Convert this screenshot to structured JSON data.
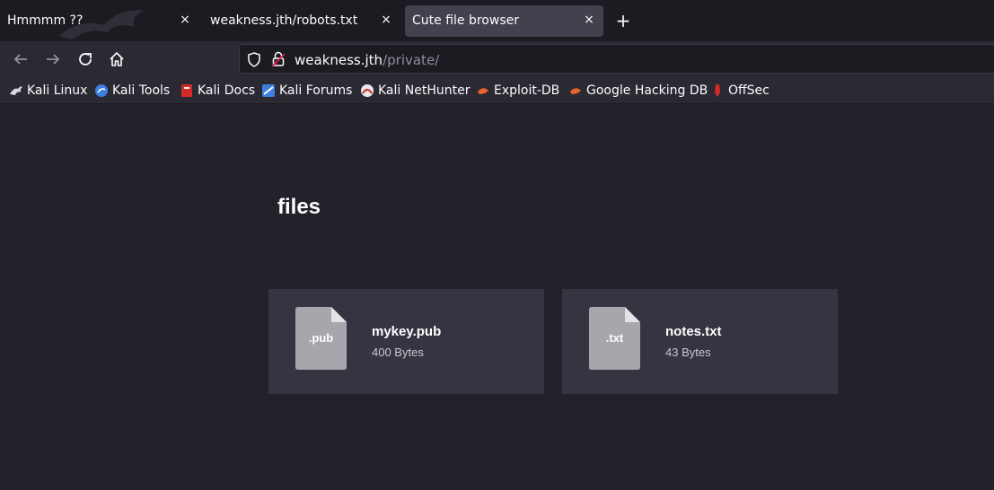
{
  "browser": {
    "tabs": [
      {
        "title": "Hmmmm ??",
        "active": false
      },
      {
        "title": "weakness.jth/robots.txt",
        "active": false
      },
      {
        "title": "Cute file browser",
        "active": true
      }
    ],
    "close_glyph": "×",
    "newtab_glyph": "+",
    "url": {
      "host": "weakness.jth",
      "path": "/private/"
    },
    "bookmarks": [
      {
        "label": "Kali Linux",
        "icon": "kali-dragon-icon"
      },
      {
        "label": "Kali Tools",
        "icon": "kali-tools-icon"
      },
      {
        "label": "Kali Docs",
        "icon": "kali-docs-icon"
      },
      {
        "label": "Kali Forums",
        "icon": "kali-forums-icon"
      },
      {
        "label": "Kali NetHunter",
        "icon": "kali-nethunter-icon"
      },
      {
        "label": "Exploit-DB",
        "icon": "exploit-db-icon"
      },
      {
        "label": "Google Hacking DB",
        "icon": "ghdb-icon"
      },
      {
        "label": "OffSec",
        "icon": "offsec-icon"
      }
    ]
  },
  "page": {
    "heading": "files",
    "files": [
      {
        "ext": ".pub",
        "name": "mykey.pub",
        "size": "400 Bytes"
      },
      {
        "ext": ".txt",
        "name": "notes.txt",
        "size": "43 Bytes"
      }
    ]
  },
  "colors": {
    "page_bg": "#23222b",
    "card_bg": "#353441",
    "file_icon": "#a6a7ad",
    "accent_red": "#e0244d"
  }
}
